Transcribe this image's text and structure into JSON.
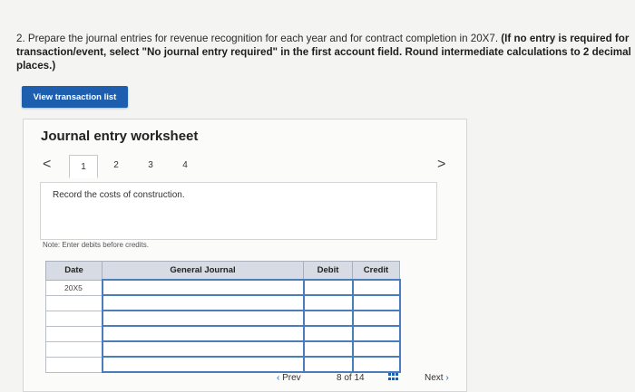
{
  "question": {
    "normal": "2. Prepare the journal entries for revenue recognition for each year and for contract completion in 20X7.",
    "bold": "(If no entry is required for transaction/event, select \"No journal entry required\" in the first account field. Round intermediate calculations to 2 decimal places.)"
  },
  "view_button_label": "View transaction list",
  "worksheet": {
    "title": "Journal entry worksheet",
    "prev_arrow": "<",
    "next_arrow": ">",
    "tabs": [
      "1",
      "2",
      "3",
      "4"
    ],
    "description": "Record the costs of construction.",
    "note": "Note: Enter debits before credits."
  },
  "table": {
    "headers": {
      "date": "Date",
      "journal": "General Journal",
      "debit": "Debit",
      "credit": "Credit"
    },
    "first_date": "20X5"
  },
  "footer": {
    "prev": "Prev",
    "page": "8 of 14",
    "next": "Next"
  }
}
